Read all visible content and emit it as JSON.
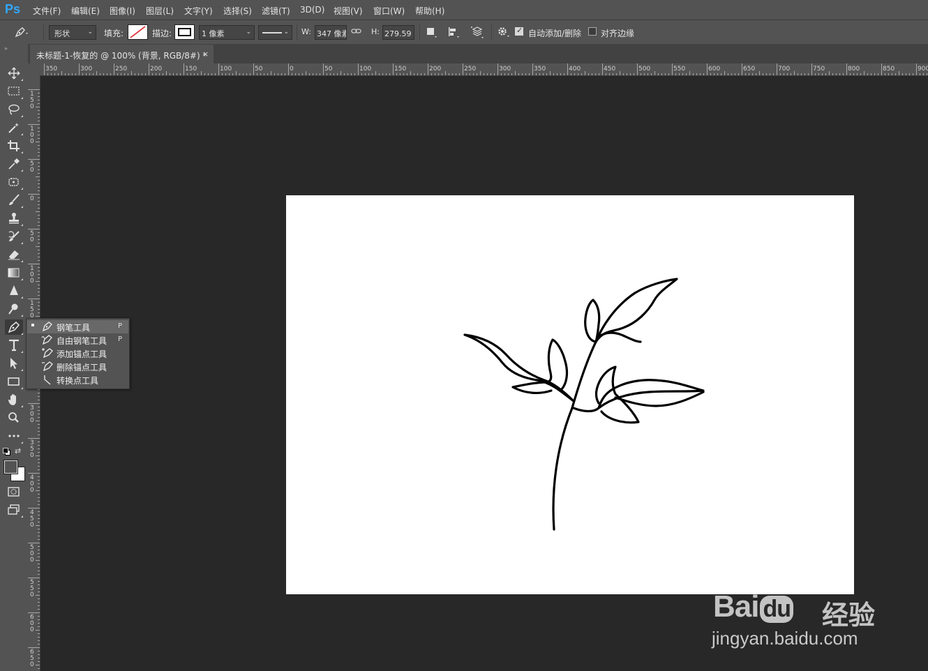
{
  "app": {
    "logo": "Ps"
  },
  "menu": [
    "文件(F)",
    "编辑(E)",
    "图像(I)",
    "图层(L)",
    "文字(Y)",
    "选择(S)",
    "滤镜(T)",
    "3D(D)",
    "视图(V)",
    "窗口(W)",
    "帮助(H)"
  ],
  "options": {
    "mode_value": "形状",
    "fill_label": "填充:",
    "stroke_label": "描边:",
    "stroke_width_value": "1 像素",
    "w_label": "W:",
    "w_value": "347 像素",
    "h_label": "H:",
    "h_value": "279.59 像",
    "auto_add_delete_label": "自动添加/删除",
    "auto_add_delete_checked": true,
    "align_edges_label": "对齐边缘",
    "align_edges_checked": false
  },
  "document": {
    "tab_title": "未标题-1-恢复的 @ 100% (背景, RGB/8#) *",
    "close_glyph": "×"
  },
  "ruler_top_labels": [
    "350",
    "300",
    "250",
    "200",
    "150",
    "100",
    "50",
    "0",
    "50",
    "100",
    "150",
    "200",
    "250",
    "300",
    "350",
    "400",
    "450",
    "500",
    "550",
    "600",
    "650",
    "700",
    "750",
    "800",
    "850",
    "900"
  ],
  "ruler_left_labels": [
    "150",
    "100",
    "50",
    "0",
    "50",
    "100",
    "150",
    "200",
    "250",
    "300",
    "350",
    "400",
    "450",
    "500",
    "550",
    "600",
    "650"
  ],
  "tools": [
    {
      "name": "move-tool-icon"
    },
    {
      "name": "marquee-tool-icon"
    },
    {
      "name": "lasso-tool-icon"
    },
    {
      "name": "magic-wand-tool-icon"
    },
    {
      "name": "crop-tool-icon"
    },
    {
      "name": "eyedropper-tool-icon"
    },
    {
      "name": "patch-tool-icon"
    },
    {
      "name": "brush-tool-icon"
    },
    {
      "name": "stamp-tool-icon"
    },
    {
      "name": "history-brush-tool-icon"
    },
    {
      "name": "eraser-tool-icon"
    },
    {
      "name": "gradient-tool-icon"
    },
    {
      "name": "blur-tool-icon"
    },
    {
      "name": "dodge-tool-icon"
    },
    {
      "name": "pen-tool-icon"
    },
    {
      "name": "type-tool-icon"
    },
    {
      "name": "path-selection-tool-icon"
    },
    {
      "name": "rectangle-tool-icon"
    },
    {
      "name": "hand-tool-icon"
    },
    {
      "name": "zoom-tool-icon"
    },
    {
      "name": "more-tools-icon"
    }
  ],
  "colors": {
    "foreground": "#535353",
    "background": "#ffffff",
    "accent": "#31a8ff"
  },
  "pen_flyout": {
    "items": [
      {
        "label": "钢笔工具",
        "key": "P",
        "selected": true
      },
      {
        "label": "自由钢笔工具",
        "key": "P",
        "selected": false
      },
      {
        "label": "添加锚点工具",
        "key": "",
        "selected": false
      },
      {
        "label": "删除锚点工具",
        "key": "",
        "selected": false
      },
      {
        "label": "转换点工具",
        "key": "",
        "selected": false
      }
    ]
  },
  "watermark": {
    "brand": "Bai",
    "brand_du": "du",
    "product": "经验",
    "url": "jingyan.baidu.com"
  }
}
